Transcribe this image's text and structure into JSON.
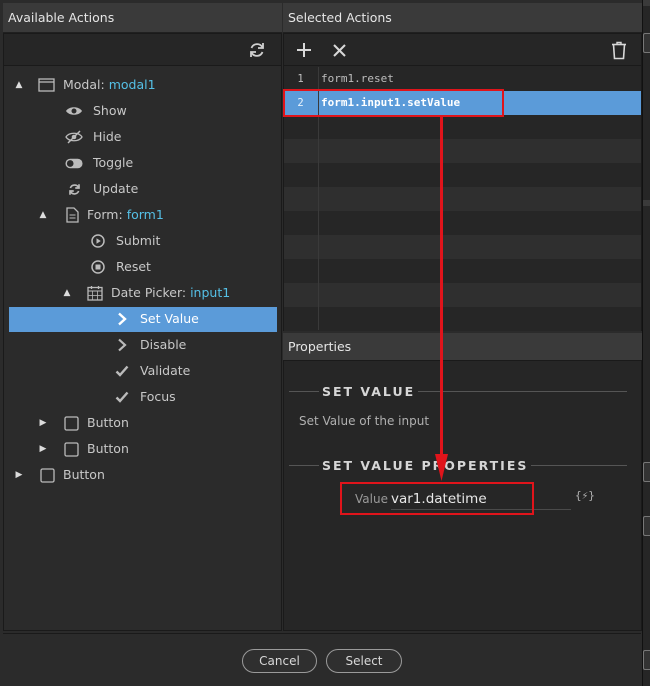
{
  "left_panel": {
    "title": "Available Actions",
    "refresh_icon": "refresh-icon",
    "tree": [
      {
        "label": "Modal:",
        "id": "modal1",
        "icon": "window-icon",
        "caret": "▲"
      },
      {
        "label": "Show",
        "icon": "eye-icon"
      },
      {
        "label": "Hide",
        "icon": "eye-slash-icon"
      },
      {
        "label": "Toggle",
        "icon": "toggle-icon"
      },
      {
        "label": "Update",
        "icon": "refresh-icon"
      },
      {
        "label": "Form:",
        "id": "form1",
        "icon": "form-icon",
        "caret": "▲"
      },
      {
        "label": "Submit",
        "icon": "circle-play-icon"
      },
      {
        "label": "Reset",
        "icon": "circle-x-icon"
      },
      {
        "label": "Date Picker:",
        "id": "input1",
        "icon": "calendar-icon",
        "caret": "▲"
      },
      {
        "label": "Set Value",
        "icon": "chevron-right-icon",
        "selected": true
      },
      {
        "label": "Disable",
        "icon": "chevron-right-icon"
      },
      {
        "label": "Validate",
        "icon": "check-icon"
      },
      {
        "label": "Focus",
        "icon": "check-icon"
      },
      {
        "label": "Button",
        "icon": "checkbox-icon",
        "caret": "▶"
      },
      {
        "label": "Button",
        "icon": "checkbox-icon",
        "caret": "▶"
      },
      {
        "label": "Button",
        "icon": "checkbox-icon",
        "caret": "▶"
      }
    ]
  },
  "right_panel": {
    "title": "Selected Actions",
    "toolbar": {
      "add_icon": "plus-icon",
      "remove_icon": "x-icon",
      "delete_icon": "trash-icon"
    },
    "actions": [
      {
        "num": "1",
        "text": "form1.reset"
      },
      {
        "num": "2",
        "text": "form1.input1.setValue",
        "selected": true
      }
    ]
  },
  "properties": {
    "title": "Properties",
    "section1": "SET VALUE",
    "description": "Set Value of the input",
    "section2": "SET VALUE PROPERTIES",
    "value_label": "Value",
    "value": "var1.datetime",
    "dynamic_icon": "{⚡}"
  },
  "footer": {
    "cancel_label": "Cancel",
    "select_label": "Select"
  },
  "colors": {
    "selection": "#5b9bd9",
    "highlight_text": "#55c0e6",
    "annotation": "#e0141b"
  }
}
